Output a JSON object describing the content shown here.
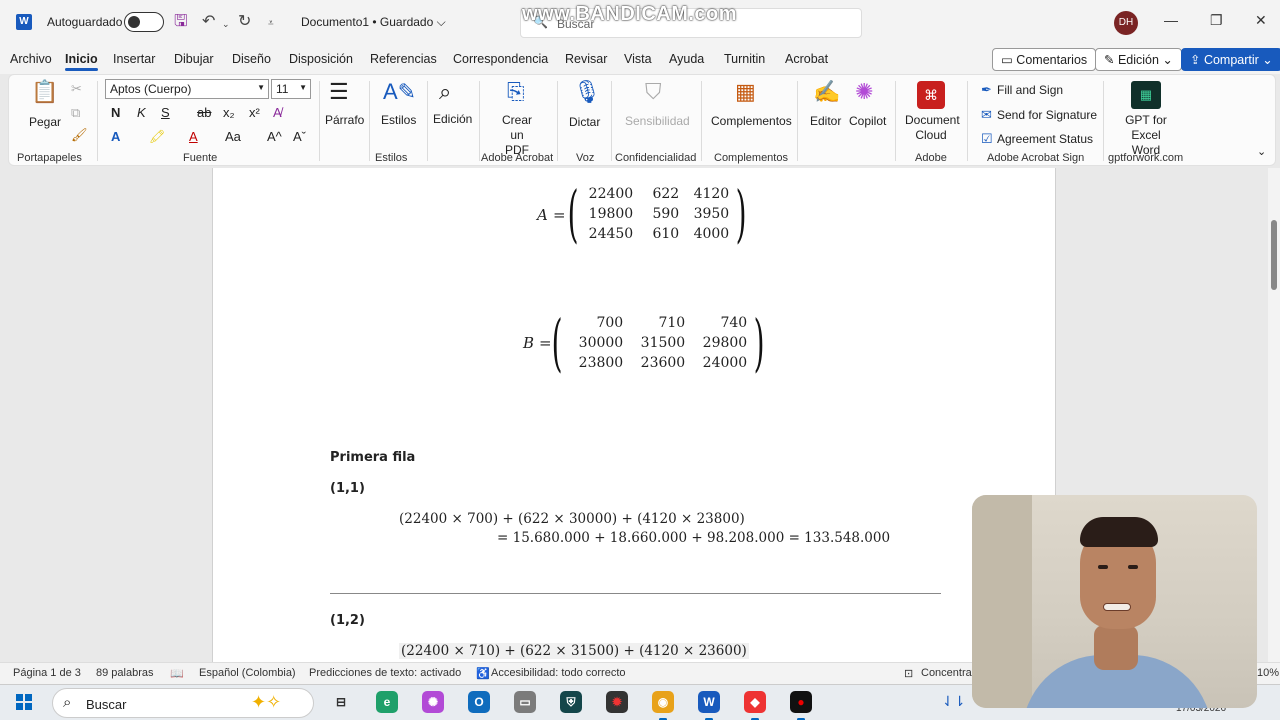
{
  "titlebar": {
    "autosave_label": "Autoguardado",
    "doc_title": "Documento1 • Guardado ⌵",
    "search_placeholder": "Buscar",
    "watermark": "www.BANDICAM.com",
    "avatar_initials": "DH"
  },
  "tabs": [
    "Archivo",
    "Inicio",
    "Insertar",
    "Dibujar",
    "Diseño",
    "Disposición",
    "Referencias",
    "Correspondencia",
    "Revisar",
    "Vista",
    "Ayuda",
    "Turnitin",
    "Acrobat"
  ],
  "active_tab": "Inicio",
  "top_buttons": {
    "comments": "Comentarios",
    "editing": "Edición ⌄",
    "share": "Compartir ⌄"
  },
  "ribbon": {
    "paste_label": "Pegar",
    "font_name": "Aptos (Cuerpo)",
    "font_size": "11",
    "bold": "N",
    "italic": "K",
    "underline": "S",
    "strike": "ab",
    "subscript": "x₂",
    "superscript": "x²",
    "paragraph_label": "Párrafo",
    "styles_label": "Estilos",
    "editing_label": "Edición",
    "create_pdf_label": "Crear un PDF",
    "dictate_label": "Dictar",
    "sensitivity_label": "Sensibilidad",
    "addins_label": "Complementos",
    "editor_label": "Editor",
    "copilot_label": "Copilot",
    "doc_cloud_label": "Document Cloud",
    "fill_sign": "Fill and Sign",
    "send_signature": "Send for Signature",
    "agreement_status": "Agreement Status",
    "gpt_label": "GPT for Excel Word",
    "groups": {
      "clipboard": "Portapapeles",
      "font": "Fuente",
      "styles": "Estilos",
      "acrobat": "Adobe Acrobat",
      "voice": "Voz",
      "confidentiality": "Confidencialidad",
      "addins": "Complementos",
      "adobe": "Adobe",
      "acrobat_sign": "Adobe Acrobat Sign",
      "gptforwork": "gptforwork.com"
    }
  },
  "document": {
    "matrix_a": {
      "name": "A",
      "rows": [
        [
          "22400",
          "622",
          "4120"
        ],
        [
          "19800",
          "590",
          "3950"
        ],
        [
          "24450",
          "610",
          "4000"
        ]
      ]
    },
    "matrix_b": {
      "name": "B",
      "rows": [
        [
          "700",
          "710",
          "740"
        ],
        [
          "30000",
          "31500",
          "29800"
        ],
        [
          "23800",
          "23600",
          "24000"
        ]
      ]
    },
    "section_heading": "Primera fila",
    "entry_11": "(1,1)",
    "eq_11_line1": "(22400 × 700) + (622 × 30000) + (4120 × 23800)",
    "eq_11_line2": "= 15.680.000 + 18.660.000 + 98.208.000 = 133.548.000",
    "entry_12": "(1,2)",
    "eq_12_line1": "(22400 × 710) + (622 × 31500) + (4120 × 23600)"
  },
  "statusbar": {
    "page": "Página 1 de 3",
    "words": "89 palabras",
    "language": "Español (Colombia)",
    "predictions": "Predicciones de texto: activado",
    "accessibility": "Accesibilidad: todo correcto",
    "focus": "Concentrac",
    "zoom": "10%"
  },
  "taskbar": {
    "search_placeholder": "Buscar",
    "date": "17/03/2026"
  },
  "colors": {
    "word_blue": "#185abd",
    "share_blue": "#185abd",
    "avatar": "#7a2424"
  }
}
